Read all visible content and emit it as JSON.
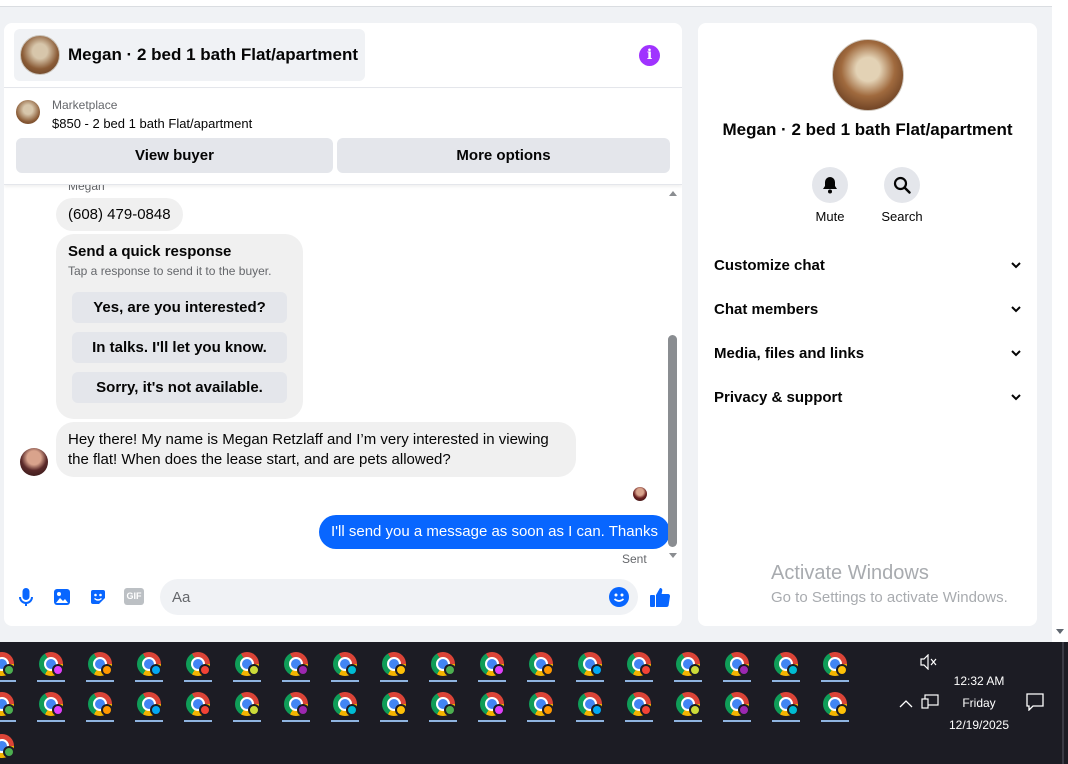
{
  "chat": {
    "title": "Megan · 2 bed 1 bath Flat/apartment",
    "marketplace_label": "Marketplace",
    "listing": "$850 - 2 bed 1 bath Flat/apartment",
    "view_buyer_label": "View buyer",
    "more_options_label": "More options",
    "sender_name": "Megan",
    "phone_message": "(608) 479-0848",
    "quick_response": {
      "title": "Send a quick response",
      "subtitle": "Tap a response to send it to the buyer.",
      "options": [
        "Yes, are you interested?",
        "In talks. I'll let you know.",
        "Sorry, it's not available."
      ]
    },
    "incoming_message": "Hey there! My name is Megan Retzlaff and I’m very interested in viewing the flat! When does the lease start, and are pets allowed?",
    "outgoing_message": "I'll send you a message as soon as I can. Thanks",
    "sent_status": "Sent",
    "composer_placeholder": "Aa",
    "gif_label": "GIF",
    "accent_color": "#0866ff"
  },
  "info_panel": {
    "title": "Megan · 2 bed 1 bath Flat/apartment",
    "mute_label": "Mute",
    "search_label": "Search",
    "sections": [
      "Customize chat",
      "Chat members",
      "Media, files and links",
      "Privacy & support"
    ]
  },
  "watermark": {
    "line1": "Activate Windows",
    "line2": "Go to Settings to activate Windows."
  },
  "taskbar": {
    "time": "12:32 AM",
    "day": "Friday",
    "date": "12/19/2025"
  }
}
